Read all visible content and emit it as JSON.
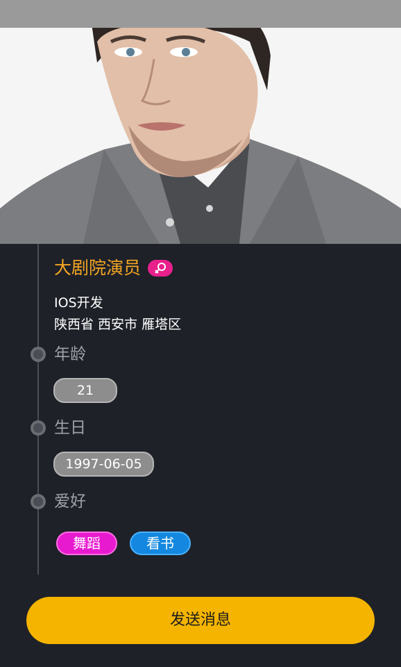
{
  "profile": {
    "name": "大剧院演员",
    "gender_icon": "female-icon",
    "job": "IOS开发",
    "location": "陕西省 西安市 雁塔区"
  },
  "sections": {
    "age": {
      "label": "年龄",
      "value": "21"
    },
    "birthday": {
      "label": "生日",
      "value": "1997-06-05"
    },
    "hobbies": {
      "label": "爱好",
      "tags": [
        "舞蹈",
        "看书"
      ]
    }
  },
  "actions": {
    "send_message": "发送消息"
  },
  "colors": {
    "background": "#1e2128",
    "name": "#f5a623",
    "gender_badge": "#e8208c",
    "tag_dance": "#e81ad0",
    "tag_read": "#1488e0",
    "button": "#f4b400"
  }
}
